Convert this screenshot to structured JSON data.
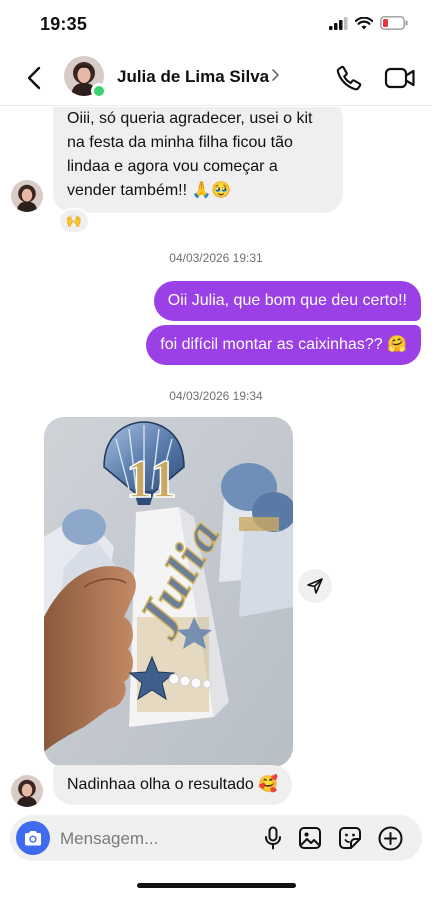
{
  "status_bar": {
    "time": "19:35"
  },
  "header": {
    "contact_name": "Julia de Lima Silva"
  },
  "messages": [
    {
      "direction": "in",
      "text": "Oiii, só queria agradecer, usei o kit na festa da minha filha ficou tão lindaa e agora vou começar a vender também!! 🙏🥹",
      "reaction": "🙌"
    },
    {
      "type": "timestamp",
      "text": "04/03/2026 19:31"
    },
    {
      "direction": "out",
      "text": "Oii Julia, que bom que deu certo!!"
    },
    {
      "direction": "out",
      "text": "foi difícil montar as caixinhas?? 🤗"
    },
    {
      "type": "timestamp",
      "text": "04/03/2026 19:34"
    },
    {
      "direction": "in",
      "type": "photo",
      "caption": "11",
      "name_on_item": "Julia"
    },
    {
      "direction": "in",
      "text": "Nadinhaa olha o resultado 🥰"
    }
  ],
  "composer": {
    "placeholder": "Mensagem..."
  },
  "colors": {
    "outgoing_bubble": "#9b3fe6",
    "incoming_bubble": "#efefef",
    "camera_button": "#3f6bf0",
    "online_dot": "#3bd16f"
  },
  "icons": [
    "signal-icon",
    "wifi-icon",
    "battery-icon",
    "back-arrow-icon",
    "chevron-right-icon",
    "phone-icon",
    "video-camera-icon",
    "send-icon",
    "camera-icon",
    "microphone-icon",
    "gallery-icon",
    "sticker-icon",
    "plus-icon"
  ]
}
